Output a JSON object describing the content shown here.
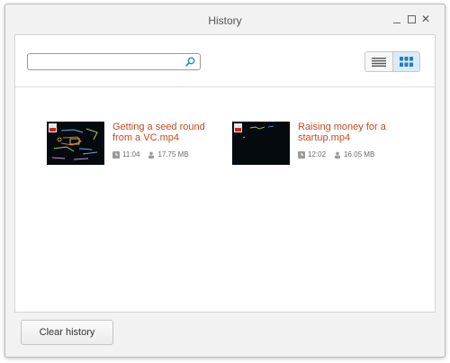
{
  "window": {
    "title": "History"
  },
  "search": {
    "value": "",
    "placeholder": ""
  },
  "view_toggle": {
    "active": "grid"
  },
  "items": [
    {
      "title": "Getting a seed round from a VC.mp4",
      "duration": "11:04",
      "size": "17.75 MB",
      "thumb_type": "whiteboard-diagram"
    },
    {
      "title": "Raising money for a startup.mp4",
      "duration": "12:02",
      "size": "16.05 MB",
      "thumb_type": "whiteboard-sparse"
    }
  ],
  "footer": {
    "clear_label": "Clear history"
  },
  "colors": {
    "title_text": "#c8481e",
    "accent": "#2a8fd0",
    "thumb_bg": "#050a0e"
  }
}
